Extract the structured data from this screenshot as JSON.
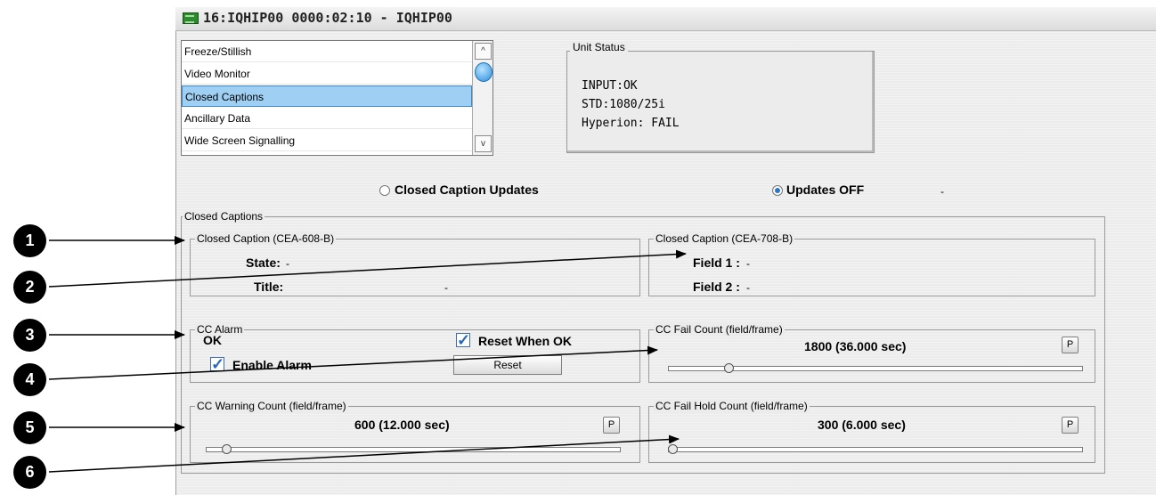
{
  "window": {
    "title": "16:IQHIP00  0000:02:10  - IQHIP00"
  },
  "menu": {
    "items": [
      "Freeze/Stillish",
      "Video Monitor",
      "Closed Captions",
      "Ancillary Data",
      "Wide Screen Signalling"
    ],
    "selected": "Closed Captions"
  },
  "unit_status": {
    "label": "Unit Status",
    "lines": [
      "INPUT:OK",
      "STD:1080/25i",
      "Hyperion: FAIL"
    ]
  },
  "radios": {
    "updates_label": "Closed Caption Updates",
    "off_label": "Updates OFF",
    "dash": "-",
    "selected": "Updates OFF"
  },
  "closed_captions": {
    "group_label": "Closed Captions",
    "cea608": {
      "label": "Closed Caption (CEA-608-B)",
      "state_label": "State:",
      "state_value": "-",
      "title_label": "Title:",
      "title_value": "-"
    },
    "cea708": {
      "label": "Closed Caption (CEA-708-B)",
      "field1_label": "Field 1 :",
      "field1_value": "-",
      "field2_label": "Field 2 :",
      "field2_value": "-"
    },
    "alarm": {
      "label": "CC Alarm",
      "status": "OK",
      "reset_when_ok": "Reset When OK",
      "reset_when_ok_checked": true,
      "enable_alarm": "Enable Alarm",
      "enable_alarm_checked": true,
      "reset_button": "Reset"
    },
    "fail_count": {
      "label": "CC Fail Count (field/frame)",
      "value": "1800 (36.000 sec)",
      "p": "P",
      "slider_fraction": 0.14
    },
    "warning_count": {
      "label": "CC Warning Count (field/frame)",
      "value": "600 (12.000 sec)",
      "p": "P",
      "slider_fraction": 0.04
    },
    "fail_hold_count": {
      "label": "CC Fail Hold Count (field/frame)",
      "value": "300 (6.000 sec)",
      "p": "P",
      "slider_fraction": 0.0
    }
  },
  "callouts": [
    "1",
    "2",
    "3",
    "4",
    "5",
    "6"
  ]
}
